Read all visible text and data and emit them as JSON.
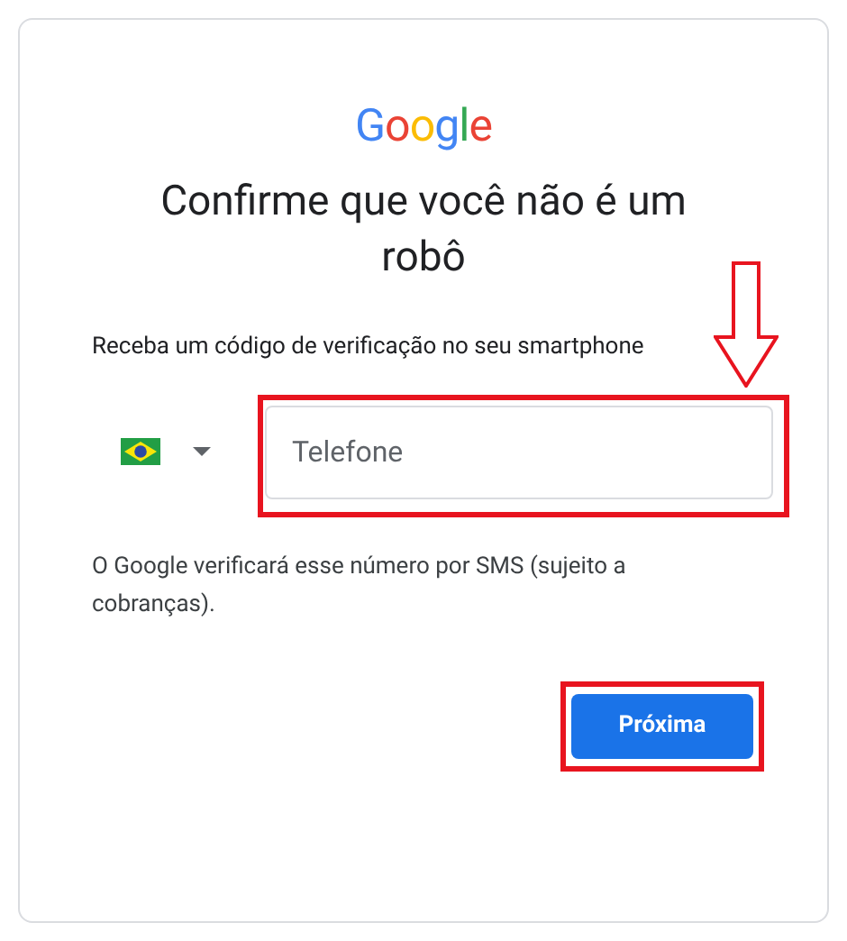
{
  "logo": [
    {
      "char": "G",
      "color": "#4285f4"
    },
    {
      "char": "o",
      "color": "#ea4335"
    },
    {
      "char": "o",
      "color": "#fbbc05"
    },
    {
      "char": "g",
      "color": "#4285f4"
    },
    {
      "char": "l",
      "color": "#34a853"
    },
    {
      "char": "e",
      "color": "#ea4335"
    }
  ],
  "title": "Confirme que você não é um robô",
  "subtitle": "Receba um código de verificação no seu smartphone",
  "phone_field": {
    "placeholder": "Telefone",
    "highlighted": true
  },
  "note": "O Google verificará esse número por SMS (sujeito a cobranças).",
  "next_button": {
    "label": "Próxima",
    "highlighted": true
  }
}
